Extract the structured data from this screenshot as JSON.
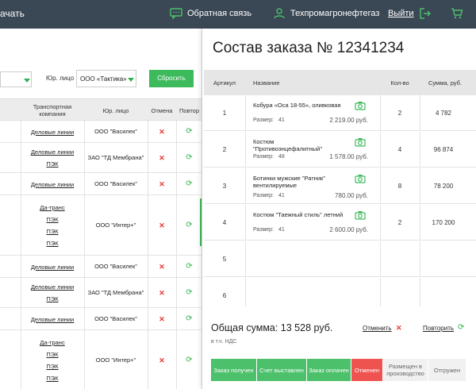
{
  "topbar": {
    "left_text": "ачать",
    "feedback_label": "Обратная связь",
    "user_label": "Техпромагронефтегаз",
    "logout_label": "Выйти"
  },
  "filters": {
    "legal_label": "Юр. лицо",
    "legal_value": "ООО «Тактика»",
    "reset_label": "Сбросить"
  },
  "left_table": {
    "headers": {
      "transport": "Транспортная компания",
      "legal": "Юр. лицо",
      "cancel": "Отмена",
      "repeat": "Повтор"
    },
    "rows": [
      {
        "transport": [
          "Деловые линии"
        ],
        "legal": "ООО \"Василек\""
      },
      {
        "transport": [
          "Деловые линии",
          "ПЭК"
        ],
        "legal": "ЗАО \"ТД Мембрана\""
      },
      {
        "transport": [
          "Деловые линии"
        ],
        "legal": "ООО \"Василек\""
      },
      {
        "transport": [
          "Да-транс",
          "ПЭК",
          "ПЭК",
          "ПЭК"
        ],
        "legal": "ООО \"Интер+\""
      },
      {
        "transport": [
          "Деловые линии"
        ],
        "legal": "ООО \"Василек\""
      },
      {
        "transport": [
          "Деловые линии",
          "ПЭК"
        ],
        "legal": "ЗАО \"ТД Мембрана\""
      },
      {
        "transport": [
          "Деловые линии"
        ],
        "legal": "ООО \"Василек\""
      },
      {
        "transport": [
          "Да-транс",
          "ПЭК",
          "ПЭК",
          "ПЭК"
        ],
        "legal": "ООО \"Интер+\""
      }
    ],
    "cancel_symbol": "✕",
    "repeat_symbol": "⟳"
  },
  "order": {
    "title": "Состав заказа № 12341234",
    "headers": {
      "article": "Артикул",
      "name": "Название",
      "qty": "Кол-во",
      "sum": "Сумма, руб."
    },
    "rows": [
      {
        "article": "1",
        "name": "Кобура «Оса 18-55», оливковая",
        "size_label": "Размер:",
        "size": "41",
        "price": "2 219.00 руб.",
        "qty": "2",
        "sum": "4 782"
      },
      {
        "article": "2",
        "name": "Костюм \"Противоэнцефалитный\"",
        "size_label": "Размер:",
        "size": "48",
        "price": "1 578.00 руб.",
        "qty": "4",
        "sum": "96 874"
      },
      {
        "article": "3",
        "name": "Ботинки мужские \"Ратник\" вентилируемые",
        "size_label": "Размер:",
        "size": "41",
        "price": "780.00 руб.",
        "qty": "8",
        "sum": "78 200"
      },
      {
        "article": "4",
        "name": "Костюм \"Таежный стиль\" летний",
        "size_label": "Размер:",
        "size": "41",
        "price": "2 600.00 руб.",
        "qty": "2",
        "sum": "170 200"
      },
      {
        "article": "5"
      },
      {
        "article": "6"
      }
    ],
    "total_label": "Общая сумма: 13 528 руб.",
    "vat_label": "в т.ч. НДС",
    "cancel_label": "Отменить",
    "repeat_label": "Повторить",
    "statuses": [
      {
        "label": "Заказ получен",
        "state": "green"
      },
      {
        "label": "Счет выставлен",
        "state": "green"
      },
      {
        "label": "Заказ оплачен",
        "state": "green"
      },
      {
        "label": "Отменен",
        "state": "red"
      },
      {
        "label": "Размещен в производство",
        "state": "grey"
      },
      {
        "label": "Отгружен",
        "state": "grey"
      }
    ]
  },
  "colors": {
    "topbar": "#3a4755",
    "accent_green": "#3dba5c",
    "cancel_red": "#e53935",
    "status_red": "#ef5350"
  }
}
